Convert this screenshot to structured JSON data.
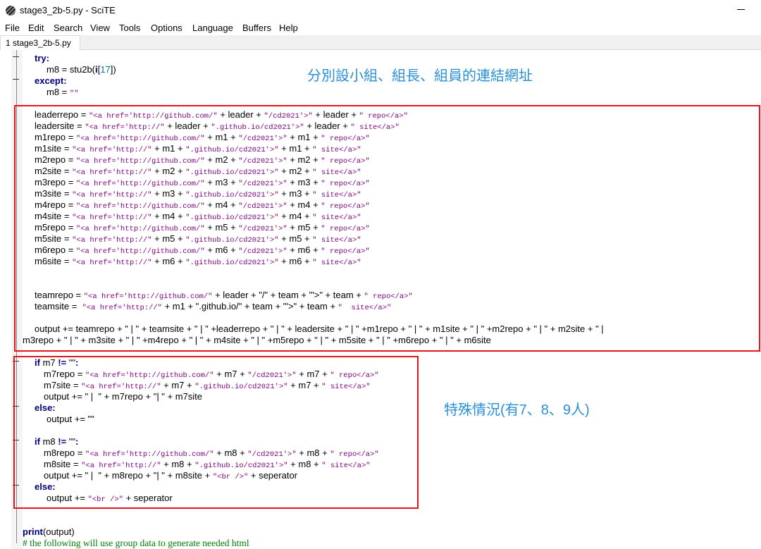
{
  "window": {
    "title": "stage3_2b-5.py - SciTE"
  },
  "menu": [
    "File",
    "Edit",
    "Search",
    "View",
    "Tools",
    "Options",
    "Language",
    "Buffers",
    "Help"
  ],
  "tab": {
    "label": "1 stage3_2b-5.py"
  },
  "annotations": {
    "top": "分別設小組、組長、組員的連結網址",
    "middle": "特殊情況(有7、8、9人)"
  },
  "code": [
    [
      [
        "kw",
        "try:"
      ]
    ],
    [
      [
        "p",
        "m8 = stu2b("
      ],
      [
        "kw",
        "i"
      ],
      [
        "p",
        "["
      ],
      [
        "num",
        "17"
      ],
      [
        "p",
        "])"
      ]
    ],
    [
      [
        "kw",
        "except:"
      ]
    ],
    [
      [
        "p",
        "m8 = "
      ],
      [
        "str",
        "\"\""
      ]
    ],
    [],
    [
      [
        "p",
        "leaderrepo = "
      ],
      [
        "str",
        "\"<a href='http://github.com/\""
      ],
      [
        "p",
        " + leader + "
      ],
      [
        "str",
        "\"/cd2021'>\""
      ],
      [
        "p",
        " + leader + "
      ],
      [
        "str",
        "\" repo</a>\""
      ]
    ],
    [
      [
        "p",
        "leadersite = "
      ],
      [
        "str",
        "\"<a href='http://\""
      ],
      [
        "p",
        " + leader + "
      ],
      [
        "str",
        "\".github.io/cd2021'>\""
      ],
      [
        "p",
        " + leader + "
      ],
      [
        "str",
        "\" site</a>\""
      ]
    ],
    [
      [
        "p",
        "m1repo = "
      ],
      [
        "str",
        "\"<a href='http://github.com/\""
      ],
      [
        "p",
        " + m1 + "
      ],
      [
        "str",
        "\"/cd2021'>\""
      ],
      [
        "p",
        " + m1 + "
      ],
      [
        "str",
        "\" repo</a>\""
      ]
    ],
    [
      [
        "p",
        "m1site = "
      ],
      [
        "str",
        "\"<a href='http://\""
      ],
      [
        "p",
        " + m1 + "
      ],
      [
        "str",
        "\".github.io/cd2021'>\""
      ],
      [
        "p",
        " + m1 + "
      ],
      [
        "str",
        "\" site</a>\""
      ]
    ],
    [
      [
        "p",
        "m2repo = "
      ],
      [
        "str",
        "\"<a href='http://github.com/\""
      ],
      [
        "p",
        " + m2 + "
      ],
      [
        "str",
        "\"/cd2021'>\""
      ],
      [
        "p",
        " + m2 + "
      ],
      [
        "str",
        "\" repo</a>\""
      ]
    ],
    [
      [
        "p",
        "m2site = "
      ],
      [
        "str",
        "\"<a href='http://\""
      ],
      [
        "p",
        " + m2 + "
      ],
      [
        "str",
        "\".github.io/cd2021'>\""
      ],
      [
        "p",
        " + m2 + "
      ],
      [
        "str",
        "\" site</a>\""
      ]
    ],
    [
      [
        "p",
        "m3repo = "
      ],
      [
        "str",
        "\"<a href='http://github.com/\""
      ],
      [
        "p",
        " + m3 + "
      ],
      [
        "str",
        "\"/cd2021'>\""
      ],
      [
        "p",
        " + m3 + "
      ],
      [
        "str",
        "\" repo</a>\""
      ]
    ],
    [
      [
        "p",
        "m3site = "
      ],
      [
        "str",
        "\"<a href='http://\""
      ],
      [
        "p",
        " + m3 + "
      ],
      [
        "str",
        "\".github.io/cd2021'>\""
      ],
      [
        "p",
        " + m3 + "
      ],
      [
        "str",
        "\" site</a>\""
      ]
    ],
    [
      [
        "p",
        "m4repo = "
      ],
      [
        "str",
        "\"<a href='http://github.com/\""
      ],
      [
        "p",
        " + m4 + "
      ],
      [
        "str",
        "\"/cd2021'>\""
      ],
      [
        "p",
        " + m4 + "
      ],
      [
        "str",
        "\" repo</a>\""
      ]
    ],
    [
      [
        "p",
        "m4site = "
      ],
      [
        "str",
        "\"<a href='http://\""
      ],
      [
        "p",
        " + m4 + "
      ],
      [
        "str",
        "\".github.io/cd2021'>\""
      ],
      [
        "p",
        " + m4 + "
      ],
      [
        "str",
        "\" site</a>\""
      ]
    ],
    [
      [
        "p",
        "m5repo = "
      ],
      [
        "str",
        "\"<a href='http://github.com/\""
      ],
      [
        "p",
        " + m5 + "
      ],
      [
        "str",
        "\"/cd2021'>\""
      ],
      [
        "p",
        " + m5 + "
      ],
      [
        "str",
        "\" repo</a>\""
      ]
    ],
    [
      [
        "p",
        "m5site = "
      ],
      [
        "str",
        "\"<a href='http://\""
      ],
      [
        "p",
        " + m5 + "
      ],
      [
        "str",
        "\".github.io/cd2021'>\""
      ],
      [
        "p",
        " + m5 + "
      ],
      [
        "str",
        "\" site</a>\""
      ]
    ],
    [
      [
        "p",
        "m6repo = "
      ],
      [
        "str",
        "\"<a href='http://github.com/\""
      ],
      [
        "p",
        " + m6 + "
      ],
      [
        "str",
        "\"/cd2021'>\""
      ],
      [
        "p",
        " + m6 + "
      ],
      [
        "str",
        "\" repo</a>\""
      ]
    ],
    [
      [
        "p",
        "m6site = "
      ],
      [
        "str",
        "\"<a href='http://\""
      ],
      [
        "p",
        " + m6 + "
      ],
      [
        "str",
        "\".github.io/cd2021'>\""
      ],
      [
        "p",
        " + m6 + "
      ],
      [
        "str",
        "\" site</a>\""
      ]
    ],
    [],
    [],
    [
      [
        "p",
        "teamrepo = "
      ],
      [
        "str",
        "\"<a href='http://github.com/\""
      ],
      [
        "p",
        " + leader + \"/\" + team + \"'>\" + team + "
      ],
      [
        "str",
        "\" repo</a>\""
      ]
    ],
    [
      [
        "p",
        "teamsite =  "
      ],
      [
        "str",
        "\"<a href='http://\""
      ],
      [
        "p",
        " + m1 + \".github.io/\" + team + \"'>\" + team + "
      ],
      [
        "str",
        "\"  site</a>\""
      ]
    ],
    [],
    [
      [
        "p",
        "output += teamrepo + \" | \" + teamsite + \" | \" +leaderrepo + \" | \" + leadersite + \" | \" +m1repo + \" | \" + m1site + \" | \" +m2repo + \" | \" + m2site + \" |"
      ]
    ],
    [
      [
        "p",
        "m3repo + \" | \" + m3site + \" | \" +m4repo + \" | \" + m4site + \" | \" +m5repo + \" | \" + m5site + \" | \" +m6repo + \" | \" + m6site"
      ]
    ],
    [],
    [
      [
        "kw",
        "if"
      ],
      [
        "p",
        " m7 "
      ],
      [
        "kw",
        "!="
      ],
      [
        "p",
        " \"\""
      ],
      [
        "kw",
        ":"
      ]
    ],
    [
      [
        "p",
        "m7repo = "
      ],
      [
        "str",
        "\"<a href='http://github.com/\""
      ],
      [
        "p",
        " + m7 + "
      ],
      [
        "str",
        "\"/cd2021'>\""
      ],
      [
        "p",
        " + m7 + "
      ],
      [
        "str",
        "\" repo</a>\""
      ]
    ],
    [
      [
        "p",
        "m7site = "
      ],
      [
        "str",
        "\"<a href='http://\""
      ],
      [
        "p",
        " + m7 + "
      ],
      [
        "str",
        "\".github.io/cd2021'>\""
      ],
      [
        "p",
        " + m7 + "
      ],
      [
        "str",
        "\" site</a>\""
      ]
    ],
    [
      [
        "p",
        "output += \" |  \" + m7repo + \"| \" + m7site"
      ]
    ],
    [
      [
        "kw",
        "else:"
      ]
    ],
    [
      [
        "p",
        "output += \"\""
      ]
    ],
    [],
    [
      [
        "kw",
        "if"
      ],
      [
        "p",
        " m8 "
      ],
      [
        "kw",
        "!="
      ],
      [
        "p",
        " \"\""
      ],
      [
        "kw",
        ":"
      ]
    ],
    [
      [
        "p",
        "m8repo = "
      ],
      [
        "str",
        "\"<a href='http://github.com/\""
      ],
      [
        "p",
        " + m8 + "
      ],
      [
        "str",
        "\"/cd2021'>\""
      ],
      [
        "p",
        " + m8 + "
      ],
      [
        "str",
        "\" repo</a>\""
      ]
    ],
    [
      [
        "p",
        "m8site = "
      ],
      [
        "str",
        "\"<a href='http://\""
      ],
      [
        "p",
        " + m8 + "
      ],
      [
        "str",
        "\".github.io/cd2021'>\""
      ],
      [
        "p",
        " + m8 + "
      ],
      [
        "str",
        "\" site</a>\""
      ]
    ],
    [
      [
        "p",
        "output += \" |  \" + m8repo + \"| \" + m8site + "
      ],
      [
        "str",
        "\"<br />\""
      ],
      [
        "p",
        " + seperator"
      ]
    ],
    [
      [
        "kw",
        "else:"
      ]
    ],
    [
      [
        "p",
        "output += "
      ],
      [
        "str",
        "\"<br />\""
      ],
      [
        "p",
        " + seperator"
      ]
    ],
    [],
    [],
    [
      [
        "kw",
        "print"
      ],
      [
        "p",
        "(output)"
      ]
    ],
    [
      [
        "cmt",
        "# the following will use group data to generate needed html"
      ]
    ]
  ]
}
